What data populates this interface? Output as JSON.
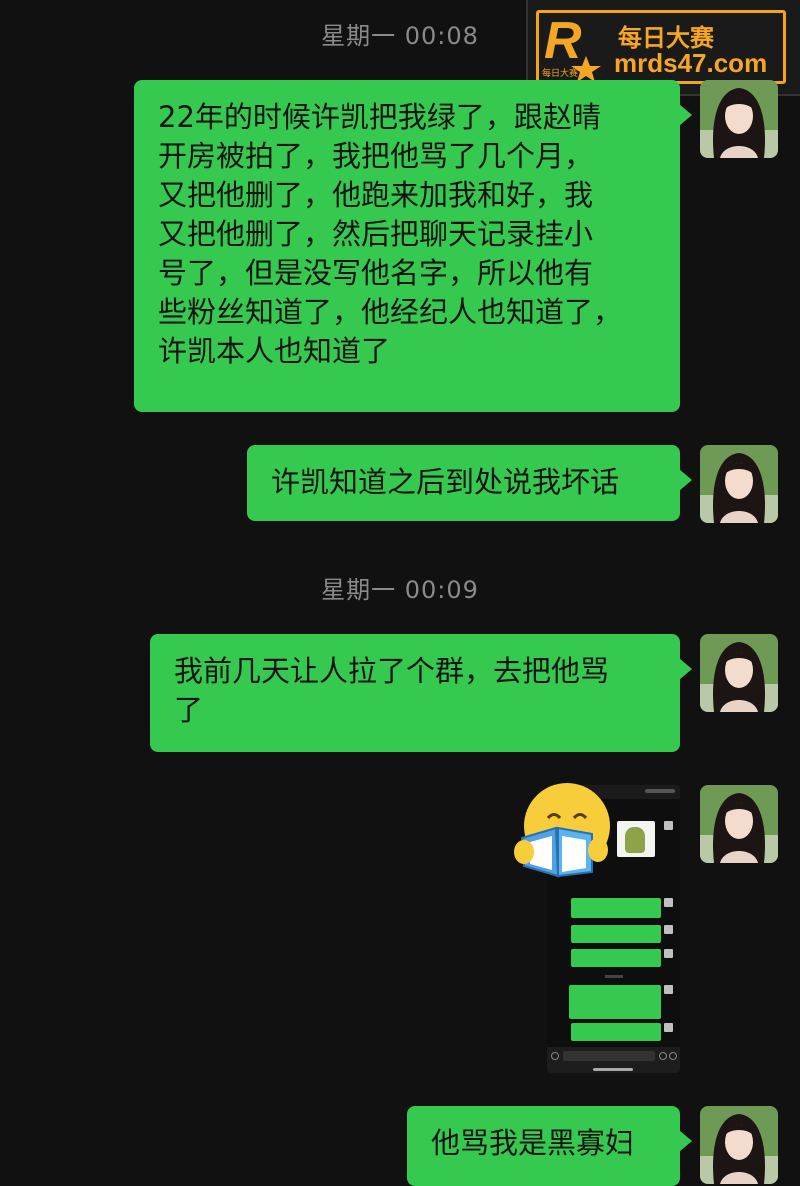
{
  "watermark": {
    "logo_letter": "R",
    "logo_caption": "每日大赛",
    "title": "每日大赛",
    "url": "mrds47.com",
    "accent_color": "#f5a623"
  },
  "messages": [
    {
      "type": "timestamp",
      "text": "星期一 00:08"
    },
    {
      "type": "sent",
      "lines": [
        "22年的时候许凯把我绿了，跟赵晴",
        "开房被拍了，我把他骂了几个月，",
        "又把他删了，他跑来加我和好，我",
        "又把他删了，然后把聊天记录挂小",
        "号了，但是没写他名字，所以他有",
        "些粉丝知道了，他经纪人也知道了，",
        "许凯本人也知道了"
      ]
    },
    {
      "type": "sent",
      "lines": [
        "许凯知道之后到处说我坏话"
      ]
    },
    {
      "type": "timestamp",
      "text": "星期一 00:09"
    },
    {
      "type": "sent",
      "lines": [
        "我前几天让人拉了个群，去把他骂",
        "了"
      ]
    },
    {
      "type": "sent-image",
      "description": "chat-screenshot"
    },
    {
      "type": "sent",
      "lines": [
        "他骂我是黑寡妇"
      ]
    }
  ],
  "colors": {
    "background": "#111111",
    "bubble": "#35c94f",
    "timestamp": "#8a8a8a"
  },
  "emoji": "reading-emoji"
}
